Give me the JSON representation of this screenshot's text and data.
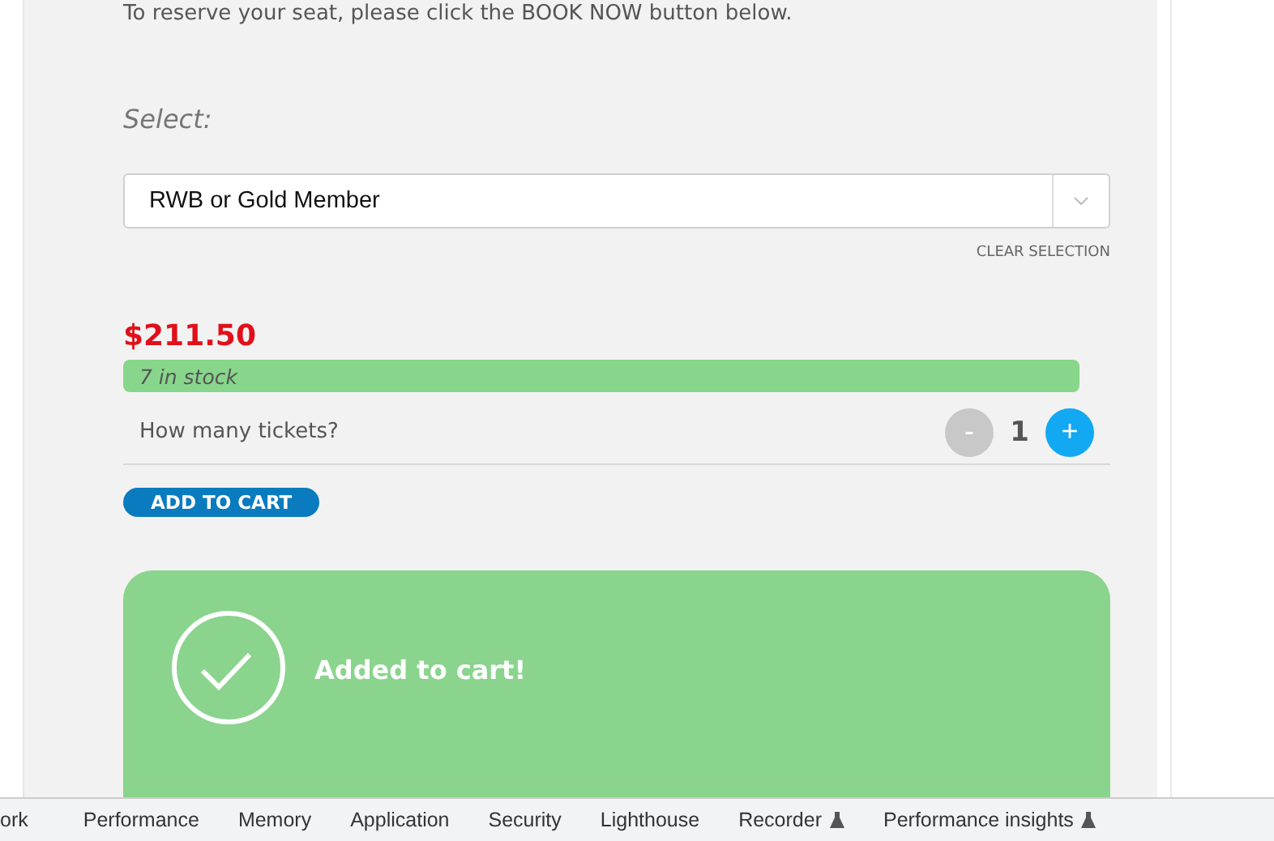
{
  "intro": "To reserve your seat, please click the BOOK NOW button below.",
  "select": {
    "label": "Select:",
    "value": "RWB or Gold Member",
    "clear": "CLEAR SELECTION"
  },
  "price": "$211.50",
  "stock": "7 in stock",
  "quantity": {
    "label": "How many tickets?",
    "minus": "-",
    "value": "1",
    "plus": "+"
  },
  "add_button": "ADD TO CART",
  "notice": "Added to cart!",
  "devtools_tabs": [
    {
      "label": "ork",
      "experimental": false
    },
    {
      "label": "Performance",
      "experimental": false
    },
    {
      "label": "Memory",
      "experimental": false
    },
    {
      "label": "Application",
      "experimental": false
    },
    {
      "label": "Security",
      "experimental": false
    },
    {
      "label": "Lighthouse",
      "experimental": false
    },
    {
      "label": "Recorder",
      "experimental": true
    },
    {
      "label": "Performance insights",
      "experimental": true
    }
  ]
}
